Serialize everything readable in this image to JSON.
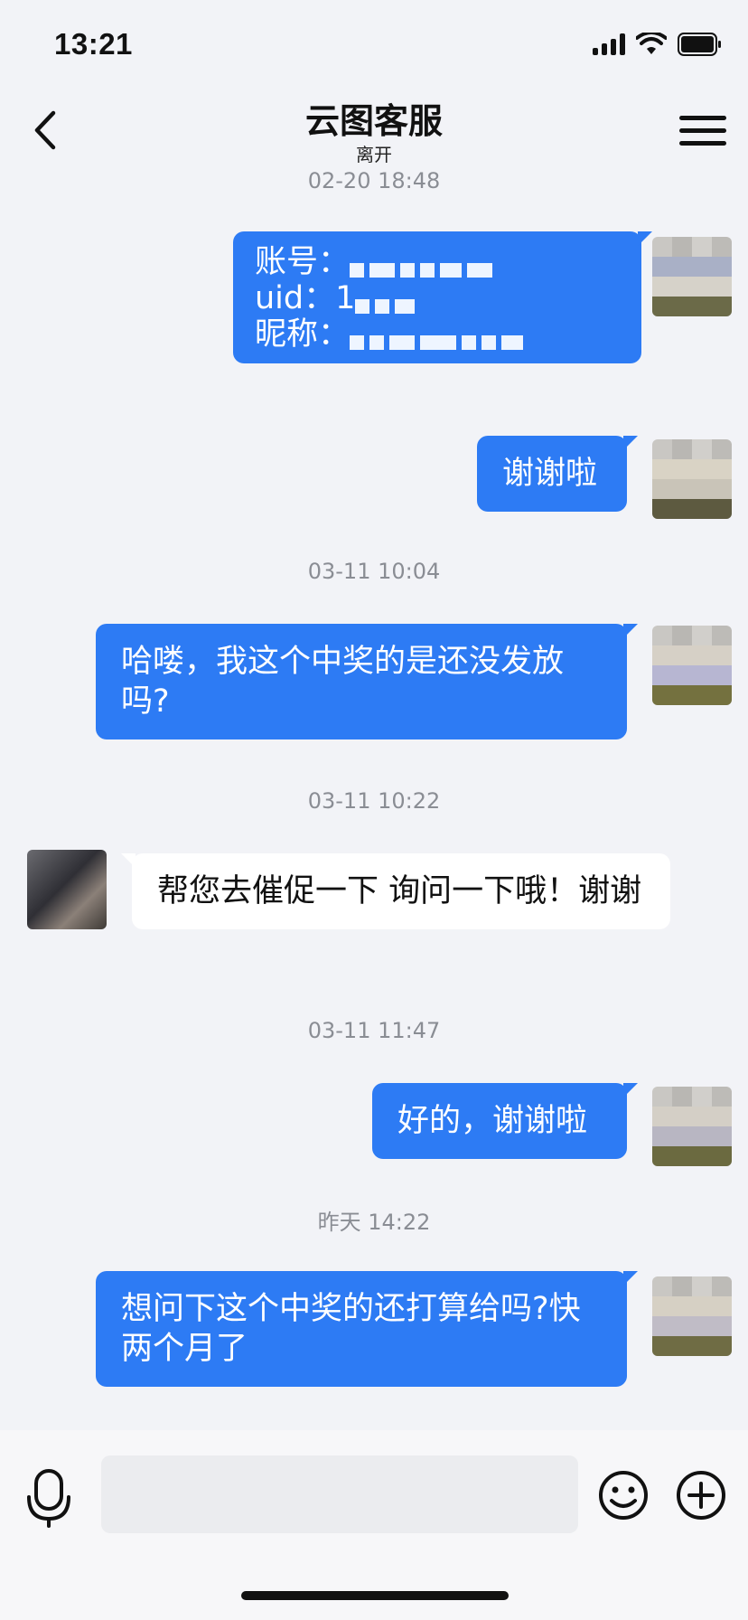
{
  "status_bar": {
    "time": "13:21"
  },
  "header": {
    "title": "云图客服",
    "status": "离开"
  },
  "messages": {
    "t0": "02-20 18:48",
    "m1": {
      "l1": "账号：",
      "l2": "uid：1",
      "l3": "昵称："
    },
    "m2": "谢谢啦",
    "t1": "03-11 10:04",
    "m3": "哈喽，我这个中奖的是还没发放吗?",
    "t2": "03-11 10:22",
    "m4": "帮您去催促一下 询问一下哦！谢谢",
    "t3": "03-11 11:47",
    "m5": "好的，谢谢啦",
    "t4": "昨天 14:22",
    "m6": "想问下这个中奖的还打算给吗?快两个月了"
  },
  "input": {
    "placeholder": ""
  },
  "colors": {
    "bubble_out": "#2d7bf4",
    "bubble_in": "#ffffff",
    "background": "#f2f3f7"
  },
  "icons": {
    "back": "chevron-left-icon",
    "menu": "menu-icon",
    "voice": "microphone-icon",
    "emoji": "smiley-icon",
    "plus": "plus-circle-icon",
    "signal": "signal-icon",
    "wifi": "wifi-icon",
    "battery": "battery-icon"
  }
}
